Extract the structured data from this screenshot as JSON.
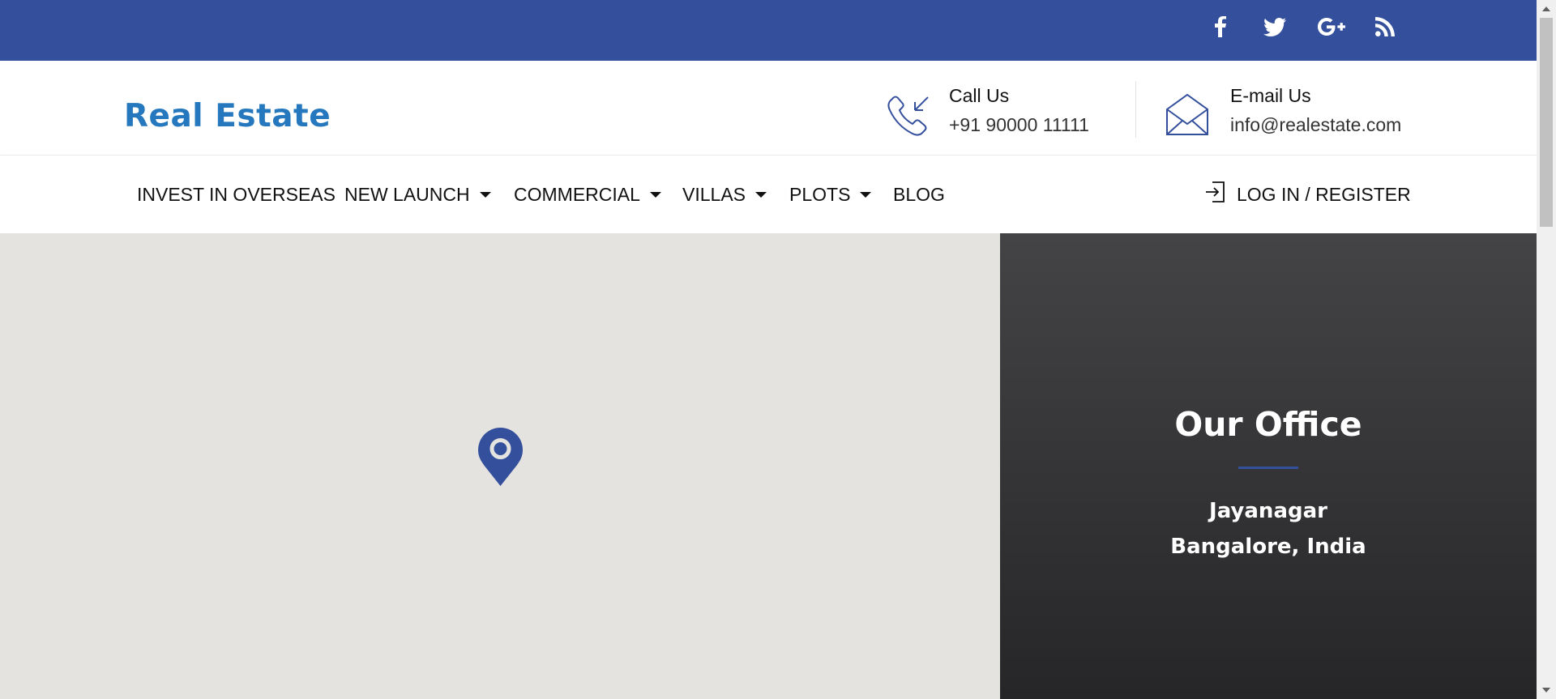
{
  "social": {
    "facebook": "facebook-icon",
    "twitter": "twitter-icon",
    "google_plus": "google-plus-icon",
    "rss": "rss-icon"
  },
  "header": {
    "logo": "Real Estate",
    "call": {
      "label": "Call Us",
      "value": "+91 90000 11111"
    },
    "email": {
      "label": "E-mail Us",
      "value": "info@realestate.com"
    }
  },
  "nav": {
    "items": [
      {
        "label": "INVEST IN OVERSEAS"
      },
      {
        "label": "NEW LAUNCH"
      },
      {
        "label": "COMMERCIAL"
      },
      {
        "label": "VILLAS"
      },
      {
        "label": "PLOTS"
      },
      {
        "label": "BLOG"
      }
    ],
    "login": "LOG IN / REGISTER"
  },
  "office": {
    "title": "Our Office",
    "line1": "Jayanagar",
    "line2": "Bangalore, India"
  },
  "colors": {
    "brand_blue": "#34509c",
    "logo_blue": "#2578bd",
    "map_bg": "#e4e3df",
    "panel_dark": "#333335"
  }
}
